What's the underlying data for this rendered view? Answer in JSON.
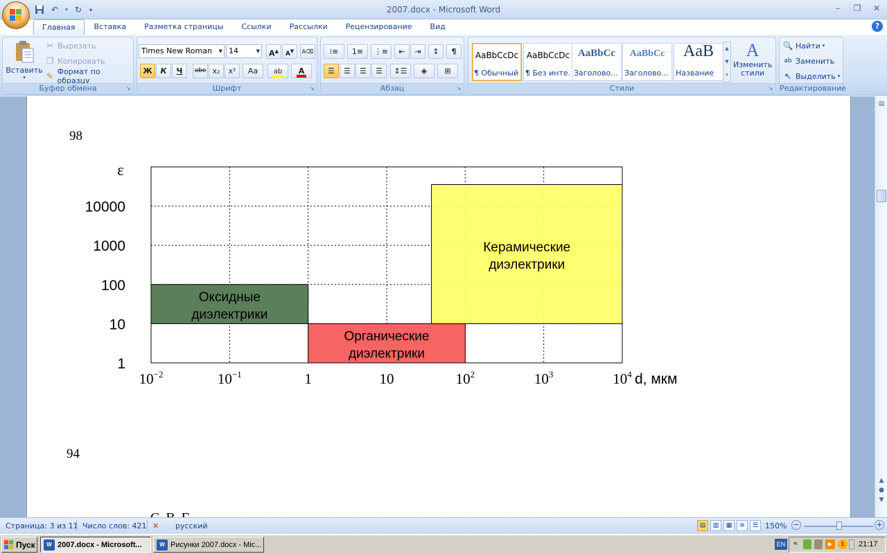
{
  "app": {
    "window_title": "2007.docx - Microsoft Word"
  },
  "quick_access": [
    "save-icon",
    "undo-icon",
    "redo-icon",
    "customize-icon"
  ],
  "ribbon": {
    "tabs": [
      "Главная",
      "Вставка",
      "Разметка страницы",
      "Ссылки",
      "Рассылки",
      "Рецензирование",
      "Вид"
    ],
    "active_tab": "Главная",
    "clipboard": {
      "label": "Буфер обмена",
      "paste": "Вставить",
      "cut": "Вырезать",
      "copy": "Копировать",
      "format_painter": "Формат по образцу"
    },
    "font": {
      "label": "Шрифт",
      "family": "Times New Roman",
      "size": "14",
      "bold": "Ж",
      "italic": "К",
      "underline": "Ч",
      "strike": "abe",
      "subscript": "x₂",
      "superscript": "x²",
      "change_case": "Aa",
      "grow": "A",
      "shrink": "A"
    },
    "paragraph": {
      "label": "Абзац"
    },
    "styles": {
      "label": "Стили",
      "items": [
        {
          "preview": "AaBbCcDc",
          "name": "¶ Обычный"
        },
        {
          "preview": "AaBbCcDc",
          "name": "¶ Без инте..."
        },
        {
          "preview": "AaBbCc",
          "name": "Заголово..."
        },
        {
          "preview": "AaBbCc",
          "name": "Заголово..."
        },
        {
          "preview": "AaB",
          "name": "Название"
        }
      ],
      "change_styles": "Изменить стили"
    },
    "editing": {
      "label": "Редактирование",
      "find": "Найти",
      "replace": "Заменить",
      "select": "Выделить"
    }
  },
  "document": {
    "page_number_top": "98",
    "page_number_bottom": "94",
    "cut_text": "С            В             Г"
  },
  "chart_data": {
    "type": "table",
    "y_symbol": "ε",
    "x_unit_label": "d, мкм",
    "y_ticks": [
      "10000",
      "1000",
      "100",
      "10",
      "1"
    ],
    "x_ticks": [
      {
        "base": "10",
        "sup": "−2"
      },
      {
        "base": "10",
        "sup": "−1"
      },
      {
        "base": "1",
        "sup": ""
      },
      {
        "base": "10",
        "sup": ""
      },
      {
        "base": "10",
        "sup": "2"
      },
      {
        "base": "10",
        "sup": "3"
      },
      {
        "base": "10",
        "sup": "4"
      }
    ],
    "x_range_log10": [
      -2,
      4
    ],
    "y_range_log10": [
      0,
      5
    ],
    "grid": "dotted",
    "regions": [
      {
        "line1": "Оксидные",
        "line2": "диэлектрики",
        "d_log10": [
          -2,
          0
        ],
        "eps_log10": [
          1,
          2
        ],
        "color": "#5a7f5a"
      },
      {
        "line1": "Органические",
        "line2": "диэлектрики",
        "d_log10": [
          0,
          2
        ],
        "eps_log10": [
          0,
          1
        ],
        "color": "#f76464"
      },
      {
        "line1": "Керамические",
        "line2": "диэлектрики",
        "d_log10": [
          1.57,
          4
        ],
        "eps_log10": [
          1,
          4.55
        ],
        "color": "#ffff66"
      }
    ]
  },
  "status": {
    "page": "Страница: 3 из 11",
    "words": "Число слов: 421",
    "language": "русский",
    "zoom": "150%"
  },
  "taskbar": {
    "start": "Пуск",
    "tasks": [
      "2007.docx - Microsoft...",
      "Рисунки 2007.docx - Mic..."
    ],
    "lang": "EN",
    "clock": "21:17"
  },
  "colors": {
    "ribbon_blue": "#15428b",
    "doc_bg": "#9eb6d6"
  }
}
